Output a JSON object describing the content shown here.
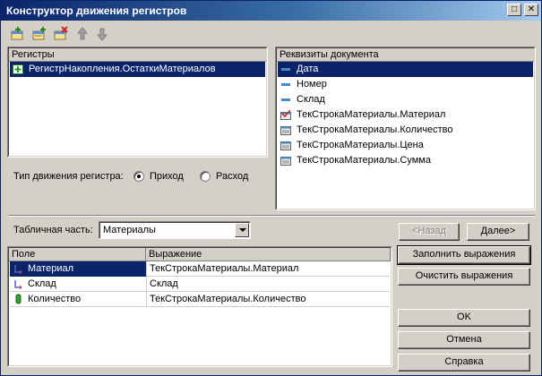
{
  "window": {
    "title": "Конструктор движения регистров",
    "minimize_glyph": "_",
    "maximize_glyph": "□",
    "close_glyph": "✕"
  },
  "toolbar": {
    "tools": [
      {
        "name": "add-register-icon"
      },
      {
        "name": "add-register-copy-icon"
      },
      {
        "name": "delete-register-icon"
      },
      {
        "name": "move-up-icon"
      },
      {
        "name": "move-down-icon"
      }
    ]
  },
  "registers": {
    "header": "Регистры",
    "items": [
      {
        "label": "РегистрНакопления.ОстаткиМатериалов",
        "selected": true
      }
    ]
  },
  "movement_type": {
    "label": "Тип движения регистра:",
    "options": [
      {
        "label": "Приход",
        "checked": true
      },
      {
        "label": "Расход",
        "checked": false
      }
    ]
  },
  "attributes": {
    "header": "Реквизиты документа",
    "items": [
      {
        "label": "Дата",
        "selected": true,
        "icon": "attribute-icon"
      },
      {
        "label": "Номер",
        "selected": false,
        "icon": "attribute-icon"
      },
      {
        "label": "Склад",
        "selected": false,
        "icon": "attribute-icon"
      },
      {
        "label": "ТекСтрокаМатериалы.Материал",
        "selected": false,
        "icon": "tabular-attribute-checked-icon"
      },
      {
        "label": "ТекСтрокаМатериалы.Количество",
        "selected": false,
        "icon": "tabular-attribute-icon"
      },
      {
        "label": "ТекСтрокаМатериалы.Цена",
        "selected": false,
        "icon": "tabular-attribute-icon"
      },
      {
        "label": "ТекСтрокаМатериалы.Сумма",
        "selected": false,
        "icon": "tabular-attribute-icon"
      }
    ]
  },
  "tabular": {
    "label": "Табличная часть:",
    "value": "Материалы"
  },
  "nav": {
    "back_label": "<Назад",
    "next_label": "Далее>"
  },
  "grid": {
    "columns": [
      "Поле",
      "Выражение"
    ],
    "rows": [
      {
        "field": "Материал",
        "expression": "ТекСтрокаМатериалы.Материал",
        "selected": true,
        "icon": "dimension-icon"
      },
      {
        "field": "Склад",
        "expression": "Склад",
        "selected": false,
        "icon": "dimension-icon"
      },
      {
        "field": "Количество",
        "expression": "ТекСтрокаМатериалы.Количество",
        "selected": false,
        "icon": "resource-icon"
      }
    ]
  },
  "actions": {
    "fill_label": "Заполнить выражения",
    "clear_label": "Очистить выражения",
    "ok_label": "OK",
    "cancel_label": "Отмена",
    "help_label": "Справка"
  },
  "colors": {
    "titlebar_start": "#0a246a",
    "selection": "#0a246a",
    "dialog_bg": "#d4d0c8"
  }
}
